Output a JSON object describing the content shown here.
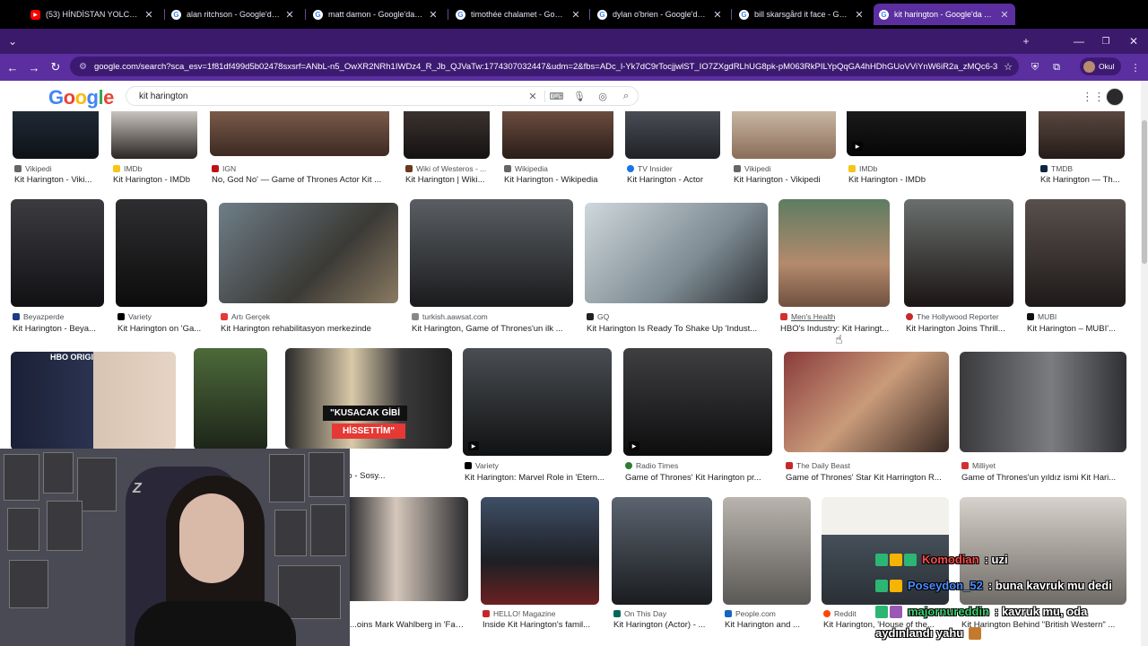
{
  "browser": {
    "tabs": [
      {
        "title": "(53) HİNDİSTAN YOLCULUĞU V...",
        "favicon": "youtube-icon",
        "active": false
      },
      {
        "title": "alan ritchson - Google'da Ara",
        "favicon": "google-icon",
        "active": false
      },
      {
        "title": "matt damon - Google'da Ara",
        "favicon": "google-icon",
        "active": false
      },
      {
        "title": "timothée chalamet - Google'da...",
        "favicon": "google-icon",
        "active": false
      },
      {
        "title": "dylan o'brien - Google'da Ara",
        "favicon": "google-icon",
        "active": false
      },
      {
        "title": "bill skarsgård it face - Google'd...",
        "favicon": "google-icon",
        "active": false
      },
      {
        "title": "kit harington - Google'da Ara",
        "favicon": "google-icon",
        "active": true
      }
    ],
    "url": "google.com/search?sca_esv=1f81df499d5b02478sxsrf=ANbL-n5_OwXR2NRh1IWDz4_R_Jb_QJVaTw:1774307032447&udm=2&fbs=ADc_l-Yk7dC9rTocjjwlST_IO7ZXgdRLhUG8pk-pM063RkPILYpQqGA4hHDhGUoVViYnW6iR2a_zMQc6-3Qx3ZyAY...",
    "profile_label": "Okul",
    "colors": {
      "tabstrip": "#3b1a6b",
      "toolbar": "#5b2fa0"
    }
  },
  "google": {
    "logo_letters": [
      "G",
      "o",
      "o",
      "g",
      "l",
      "e"
    ],
    "query": "kit harington"
  },
  "results": {
    "row1": [
      {
        "source": "Vikipedi",
        "caption": "Kit Harington - Viki..."
      },
      {
        "source": "IMDb",
        "caption": "Kit Harington - IMDb"
      },
      {
        "source": "IGN",
        "caption": "No, God No' — Game of Thrones Actor Kit ..."
      },
      {
        "source": "Wiki of Westeros - ...",
        "caption": "Kit Harington | Wiki..."
      },
      {
        "source": "Wikipedia",
        "caption": "Kit Harington - Wikipedia"
      },
      {
        "source": "TV Insider",
        "caption": "Kit Harington - Actor"
      },
      {
        "source": "Vikipedi",
        "caption": "Kit Harington - Vikipedi"
      },
      {
        "source": "IMDb",
        "caption": "Kit Harington - IMDb"
      },
      {
        "source": "TMDB",
        "caption": "Kit Harington — Th..."
      }
    ],
    "row2": [
      {
        "source": "Beyazperde",
        "caption": "Kit Harington - Beya..."
      },
      {
        "source": "Variety",
        "caption": "Kit Harington on 'Ga..."
      },
      {
        "source": "Artı Gerçek",
        "caption": "Kit Harington rehabilitasyon merkezinde"
      },
      {
        "source": "turkish.aawsat.com",
        "caption": "Kit Harington, Game of Thrones'un ilk ..."
      },
      {
        "source": "GQ",
        "caption": "Kit Harington Is Ready To Shake Up 'Indust..."
      },
      {
        "source": "Men's Health",
        "caption": "HBO's Industry: Kit Haringt..."
      },
      {
        "source": "The Hollywood Reporter",
        "caption": "Kit Harington Joins Thrill..."
      },
      {
        "source": "MUBI",
        "caption": "Kit Harington – MUBI'..."
      }
    ],
    "row3": [
      {
        "source": "",
        "caption": "",
        "overlay": "HBO ORIGI"
      },
      {
        "source": "",
        "caption": ""
      },
      {
        "source": "",
        "caption": "...berleri | Onedio - Sosy...",
        "overlay_line1": "\"KUSACAK GİBİ",
        "overlay_line2": "HİSSETTİM\""
      },
      {
        "source": "Variety",
        "caption": "Kit Harington: Marvel Role in 'Etern..."
      },
      {
        "source": "Radio Times",
        "caption": "Game of Thrones' Kit Harington pr..."
      },
      {
        "source": "The Daily Beast",
        "caption": "Game of Thrones' Star Kit Harrington R..."
      },
      {
        "source": "Milliyet",
        "caption": "Game of Thrones'un yıldız ismi Kit Hari..."
      }
    ],
    "row4": [
      {
        "source": "",
        "caption": "...oins Mark Wahlberg in 'Famil..."
      },
      {
        "source": "HELLO! Magazine",
        "caption": "Inside Kit Harington's famil..."
      },
      {
        "source": "On This Day",
        "caption": "Kit Harington (Actor) - ..."
      },
      {
        "source": "People.com",
        "caption": "Kit Harington and ..."
      },
      {
        "source": "Reddit",
        "caption": "Kit Harington, 'House of the..."
      },
      {
        "source": "",
        "caption": "Kit Harington Behind \"British Western\" ..."
      }
    ]
  },
  "chat": [
    {
      "user": "Komodian",
      "user_color": "#ff4a4a",
      "message": ": uzi"
    },
    {
      "user": "Poseydon_52",
      "user_color": "#4a8cff",
      "message": ": buna kavruk mu dedi"
    },
    {
      "user": "majornureddin",
      "user_color": "#3bd16f",
      "message": ": kavruk mu, oda"
    },
    {
      "user": "",
      "user_color": "#ffffff",
      "message": "aydınlandı yahu"
    }
  ]
}
